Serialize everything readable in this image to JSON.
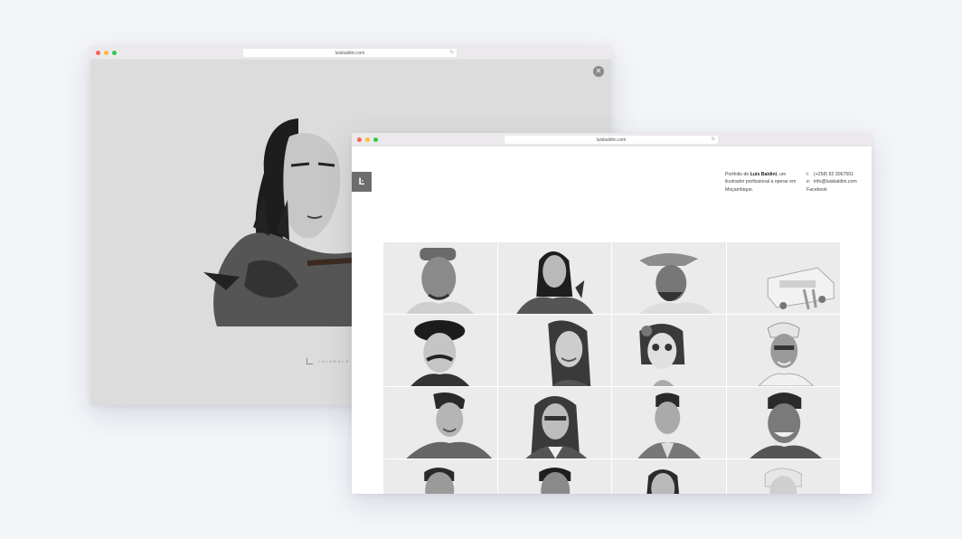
{
  "back_window": {
    "url": "luisbaldini.com",
    "close_icon": "close-icon",
    "brand_text": "LUISBALD"
  },
  "front_window": {
    "url": "luisbaldini.com",
    "logo_text": "Ŀ",
    "intro": {
      "prefix": "Portfolio de ",
      "name": "Luis Baldini",
      "suffix": ", um ilustrador profissional a operar em Moçambique."
    },
    "contact": {
      "phone_label": "t:",
      "phone": "(+258) 82 3067501",
      "email_label": "e:",
      "email": "info@luisbaldini.com",
      "facebook": "Facebook"
    },
    "tiles": [
      "portrait-man-cap",
      "portrait-warrior-woman",
      "portrait-man-hat",
      "illustration-bus",
      "portrait-man-beret",
      "portrait-woman-smiling",
      "portrait-day-of-dead",
      "portrait-old-man-glasses",
      "portrait-young-man",
      "portrait-woman-glasses",
      "portrait-man-shirt",
      "portrait-man-laughing",
      "portrait-partial-1",
      "portrait-partial-2",
      "portrait-partial-3",
      "portrait-partial-4"
    ]
  }
}
